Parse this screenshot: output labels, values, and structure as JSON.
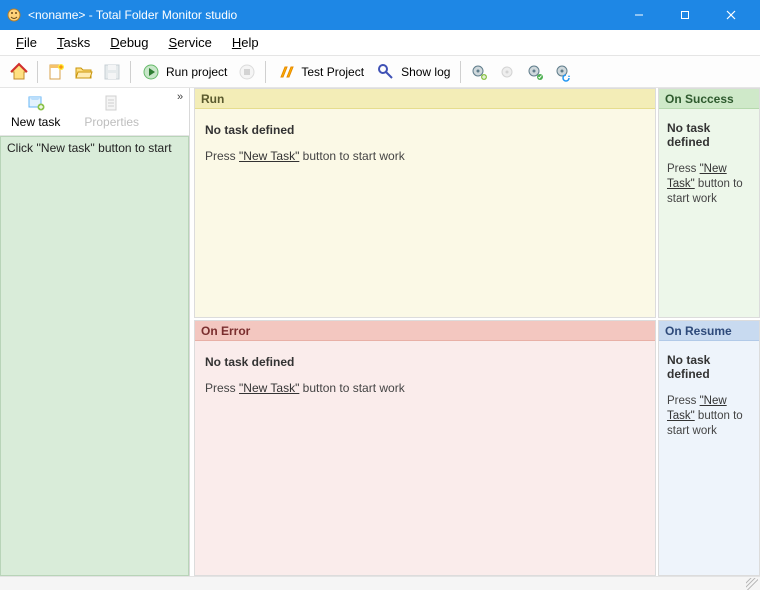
{
  "window": {
    "title": "<noname> - Total Folder Monitor studio"
  },
  "menu": {
    "file": "File",
    "tasks": "Tasks",
    "debug": "Debug",
    "service": "Service",
    "help": "Help"
  },
  "toolbar": {
    "run_project": "Run project",
    "test_project": "Test Project",
    "show_log": "Show log"
  },
  "sidebar": {
    "new_task": "New task",
    "properties": "Properties",
    "hint": "Click ''New task'' button to start"
  },
  "panels": {
    "run": {
      "title": "Run",
      "heading": "No task defined",
      "prefix": "Press ",
      "link": "\"New Task\"",
      "suffix": " button to start work"
    },
    "success": {
      "title": "On Success",
      "heading": "No task defined",
      "prefix": "Press ",
      "link": "\"New Task\"",
      "suffix": " button to start work"
    },
    "error": {
      "title": "On Error",
      "heading": "No task defined",
      "prefix": "Press ",
      "link": "\"New Task\"",
      "suffix": " button to start work"
    },
    "resume": {
      "title": "On Resume",
      "heading": "No task defined",
      "prefix": "Press ",
      "link": "\"New Task\"",
      "suffix": " button to start work"
    }
  }
}
